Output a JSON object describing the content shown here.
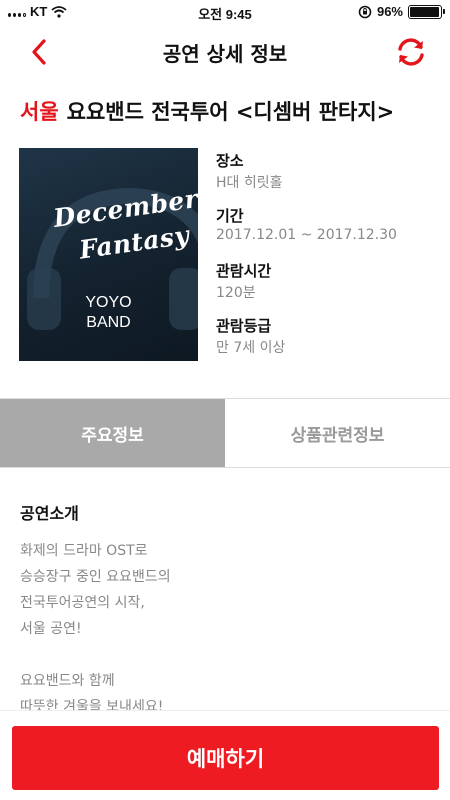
{
  "status_bar": {
    "carrier": "KT",
    "time": "오전 9:45",
    "battery_text": "96%",
    "battery_level": 0.96,
    "icons": [
      "signal-icon",
      "wifi-icon",
      "orientation-lock-icon",
      "battery-icon"
    ]
  },
  "header": {
    "title": "공연 상세 정보",
    "back_icon": "chevron-left-icon",
    "refresh_icon": "refresh-icon"
  },
  "show": {
    "city": "서울",
    "name": "요요밴드 전국투어 <디셈버 판타지>",
    "poster": {
      "line1": "December",
      "line2": "Fantasy",
      "band_line1": "YOYO",
      "band_line2": "BAND"
    },
    "info": [
      {
        "label": "장소",
        "value": "H대 히릿홀"
      },
      {
        "label": "기간",
        "value": "2017.12.01 ~ 2017.12.30"
      },
      {
        "label": "관람시간",
        "value": "120분"
      },
      {
        "label": "관람등급",
        "value": "만 7세 이상"
      }
    ]
  },
  "tabs": [
    {
      "label": "주요정보",
      "active": true
    },
    {
      "label": "상품관련정보",
      "active": false
    }
  ],
  "intro": {
    "heading": "공연소개",
    "paragraph1": [
      "화제의 드라마 OST로",
      "승승장구 중인 요요밴드의",
      "전국투어공연의 시작,",
      "서울 공연!"
    ],
    "paragraph2": [
      "요요밴드와 함께",
      "따뜻한 겨울을 보내세요!"
    ]
  },
  "book_button": {
    "label": "예매하기"
  },
  "colors": {
    "accent": "#ee1b23",
    "active_tab": "#a9a9a9",
    "muted_text": "#888888"
  }
}
